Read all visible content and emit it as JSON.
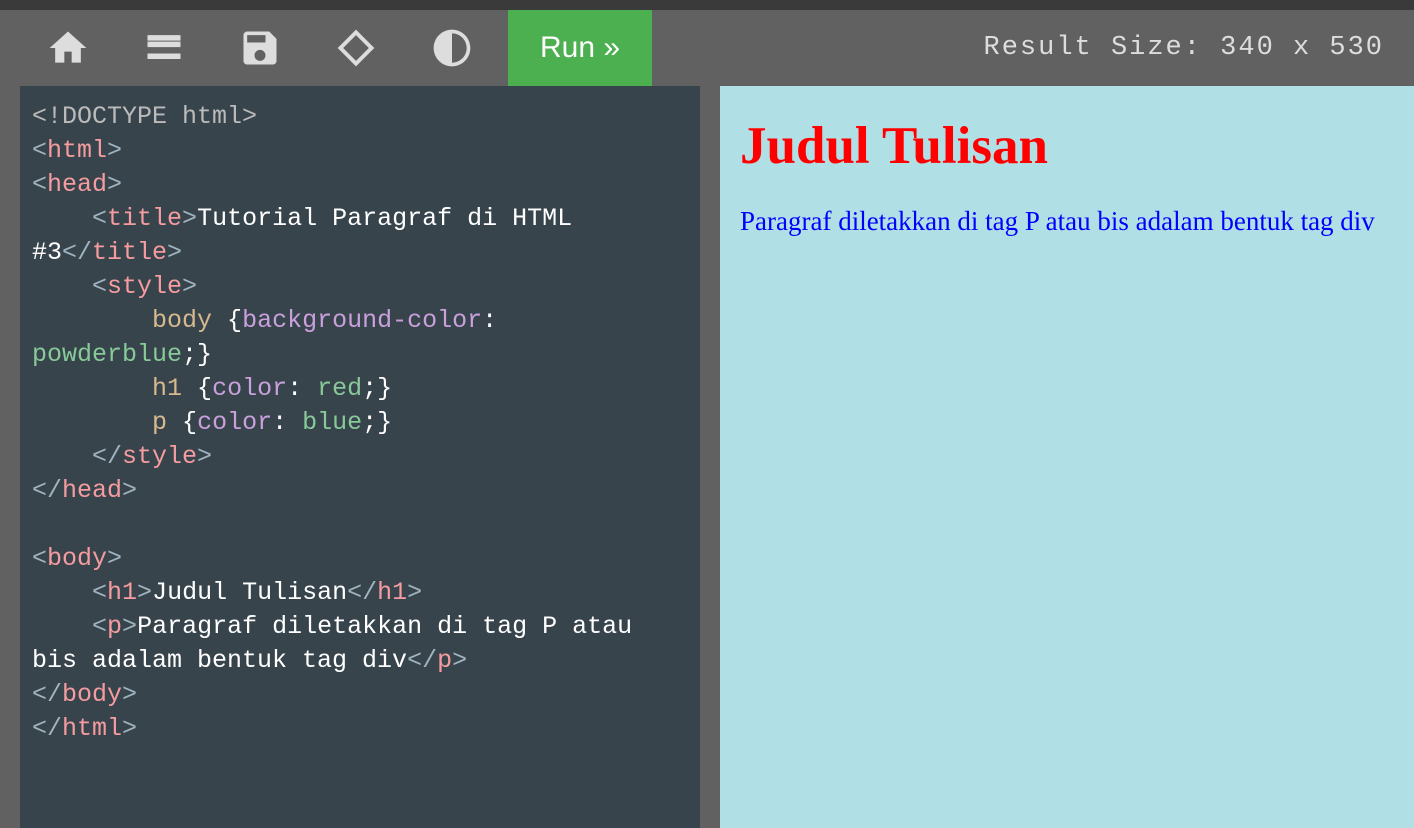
{
  "toolbar": {
    "run_label": "Run »"
  },
  "result_size": {
    "label": "Result Size:",
    "width": "340",
    "sep": "x",
    "height": "530"
  },
  "code": {
    "doctype": "<!DOCTYPE html>",
    "html_open1": "<",
    "html_tag": "html",
    "html_open2": ">",
    "head_open1": "<",
    "head_tag": "head",
    "head_open2": ">",
    "title_open1": "<",
    "title_tag": "title",
    "title_open2": ">",
    "title_text": "Tutorial Paragraf di HTML #3",
    "title_close1": "</",
    "title_close2": ">",
    "style_open1": "<",
    "style_tag": "style",
    "style_open2": ">",
    "css_body_sel": "body",
    "css_body_brace_open": " {",
    "css_body_prop": "background-color",
    "css_body_colon": ": ",
    "css_body_val": "powderblue",
    "css_body_end": ";}",
    "css_h1_sel": "h1",
    "css_h1_brace_open": " {",
    "css_h1_prop": "color",
    "css_h1_colon": ": ",
    "css_h1_val": "red",
    "css_h1_end": ";}",
    "css_p_sel": "p",
    "css_p_brace_open": " {",
    "css_p_prop": "color",
    "css_p_colon": ": ",
    "css_p_val": "blue",
    "css_p_end": ";}",
    "style_close1": "</",
    "style_close2": ">",
    "head_close1": "</",
    "head_close2": ">",
    "body_open1": "<",
    "body_tag": "body",
    "body_open2": ">",
    "h1_open1": "<",
    "h1_tag": "h1",
    "h1_open2": ">",
    "h1_text": "Judul Tulisan",
    "h1_close1": "</",
    "h1_close2": ">",
    "p_open1": "<",
    "p_tag": "p",
    "p_open2": ">",
    "p_text": "Paragraf diletakkan di tag P atau bis adalam bentuk tag div",
    "p_close1": "</",
    "p_close2": ">",
    "body_close1": "</",
    "body_close2": ">",
    "html_close1": "</",
    "html_close2": ">"
  },
  "result": {
    "heading": "Judul Tulisan",
    "paragraph": "Paragraf diletakkan di tag P atau bis adalam bentuk tag div"
  }
}
